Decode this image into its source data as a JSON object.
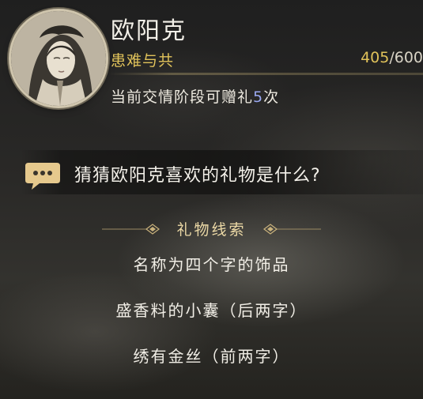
{
  "character": {
    "name": "欧阳克",
    "relationship_stage": "患难与共",
    "affinity_current": "405",
    "affinity_max": "/600"
  },
  "gift_limit": {
    "prefix": "当前交情阶段可赠礼",
    "count": "5",
    "suffix": "次"
  },
  "question": "猜猜欧阳克喜欢的礼物是什么?",
  "clue_section": {
    "title": "礼物线索",
    "clues": [
      "名称为四个字的饰品",
      "盛香料的小囊（后两字）",
      "绣有金丝（前两字）"
    ]
  },
  "colors": {
    "stage_gold": "#e0c25a",
    "count_blue": "#9aa8f0",
    "clue_title": "#ecd9a6",
    "bubble_gold": "#e6c98d"
  }
}
